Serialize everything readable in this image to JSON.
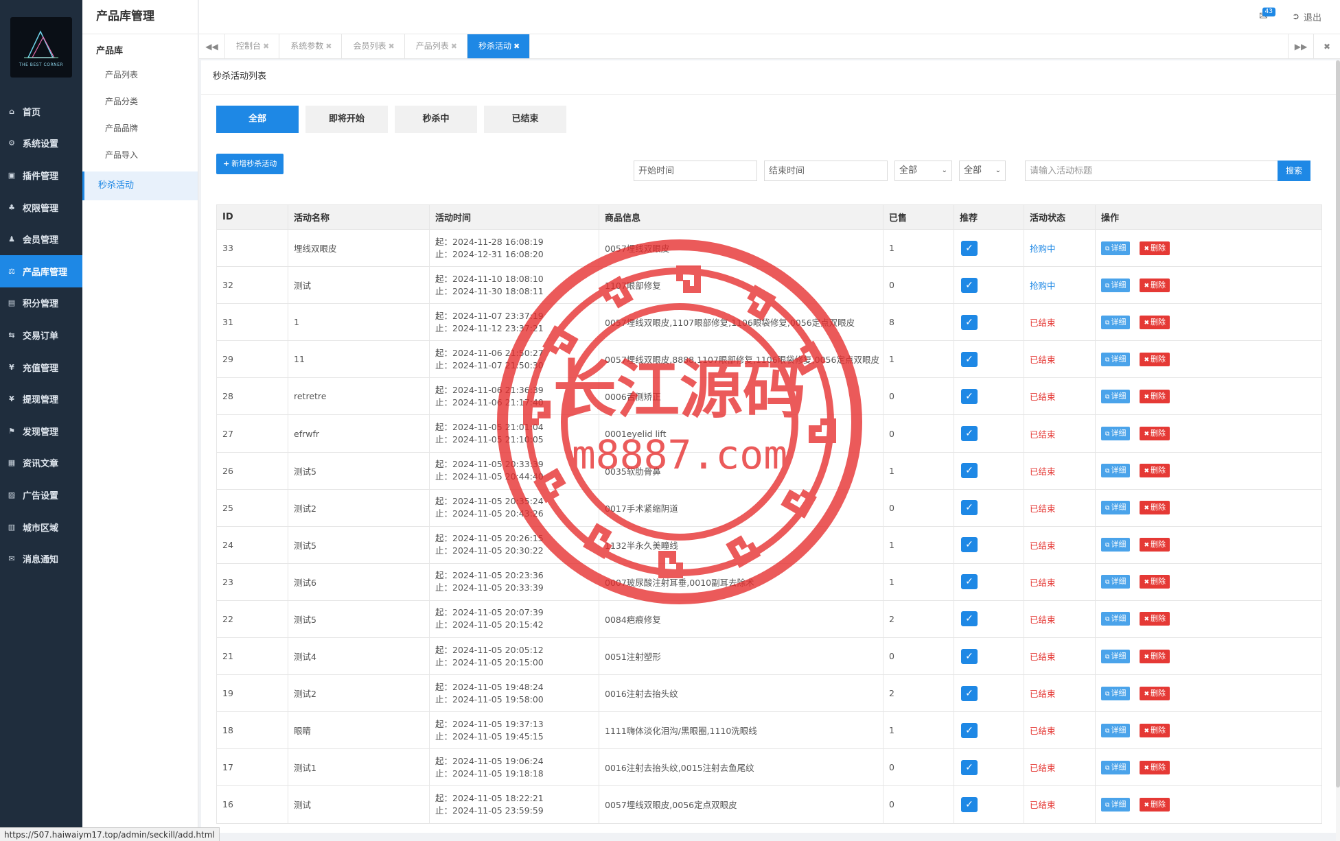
{
  "brand": {
    "logo_text": "THE BEST CORNER"
  },
  "sidebar": {
    "items": [
      {
        "label": "首页",
        "icon": "home-icon",
        "glyph": "⌂"
      },
      {
        "label": "系统设置",
        "icon": "gear-icon",
        "glyph": "⚙"
      },
      {
        "label": "插件管理",
        "icon": "plugin-icon",
        "glyph": "▣"
      },
      {
        "label": "权限管理",
        "icon": "sitemap-icon",
        "glyph": "♣"
      },
      {
        "label": "会员管理",
        "icon": "users-icon",
        "glyph": "♟"
      },
      {
        "label": "产品库管理",
        "icon": "balance-icon",
        "glyph": "⚖",
        "active": true
      },
      {
        "label": "积分管理",
        "icon": "document-icon",
        "glyph": "▤"
      },
      {
        "label": "交易订单",
        "icon": "transfer-icon",
        "glyph": "⇆"
      },
      {
        "label": "充值管理",
        "icon": "yen-icon",
        "glyph": "¥"
      },
      {
        "label": "提现管理",
        "icon": "yen-icon",
        "glyph": "¥"
      },
      {
        "label": "发现管理",
        "icon": "flag-icon",
        "glyph": "⚑"
      },
      {
        "label": "资讯文章",
        "icon": "newspaper-icon",
        "glyph": "▦"
      },
      {
        "label": "广告设置",
        "icon": "image-icon",
        "glyph": "▨"
      },
      {
        "label": "城市区域",
        "icon": "map-icon",
        "glyph": "▥"
      },
      {
        "label": "消息通知",
        "icon": "comment-icon",
        "glyph": "✉"
      }
    ]
  },
  "subsidebar": {
    "title": "产品库管理",
    "group": "产品库",
    "items": [
      "产品列表",
      "产品分类",
      "产品品牌",
      "产品导入"
    ],
    "active_item": "秒杀活动"
  },
  "header": {
    "badge": "43",
    "logout": "退出"
  },
  "tabs": [
    {
      "label": "控制台"
    },
    {
      "label": "系统参数"
    },
    {
      "label": "会员列表"
    },
    {
      "label": "产品列表"
    },
    {
      "label": "秒杀活动",
      "active": true
    }
  ],
  "panel": {
    "title": "秒杀活动列表"
  },
  "filters": {
    "tabs": [
      "全部",
      "即将开始",
      "秒杀中",
      "已结束"
    ],
    "add_button": "新增秒杀活动",
    "start_placeholder": "开始时间",
    "end_placeholder": "结束时间",
    "select_1": "全部",
    "select_2": "全部",
    "search_placeholder": "请输入活动标题",
    "search_button": "搜索"
  },
  "table": {
    "columns": [
      "ID",
      "活动名称",
      "活动时间",
      "商品信息",
      "已售",
      "推荐",
      "活动状态",
      "操作"
    ],
    "start_prefix": "起：",
    "end_prefix": "止：",
    "detail_label": "详细",
    "delete_label": "删除",
    "rows": [
      {
        "id": "33",
        "name": "埋线双眼皮",
        "start": "2024-11-28 16:08:19",
        "end": "2024-12-31 16:08:20",
        "goods": "0057埋线双眼皮",
        "sold": "1",
        "recommended": true,
        "status": "抢购中",
        "status_type": "active"
      },
      {
        "id": "32",
        "name": "测试",
        "start": "2024-11-10 18:08:10",
        "end": "2024-11-30 18:08:11",
        "goods": "1107眼部修复",
        "sold": "0",
        "recommended": true,
        "status": "抢购中",
        "status_type": "active"
      },
      {
        "id": "31",
        "name": "1",
        "start": "2024-11-07 23:37:19",
        "end": "2024-11-12 23:37:21",
        "goods": "0057埋线双眼皮,1107眼部修复,1106眼袋修复,0056定点双眼皮",
        "sold": "8",
        "recommended": true,
        "status": "已结束",
        "status_type": "ended"
      },
      {
        "id": "29",
        "name": "11",
        "start": "2024-11-06 21:50:27",
        "end": "2024-11-07 21:50:30",
        "goods": "0057埋线双眼皮,8888,1107眼部修复,1106眼袋修复,0056定点双眼皮",
        "sold": "1",
        "recommended": true,
        "status": "已结束",
        "status_type": "ended"
      },
      {
        "id": "28",
        "name": "retretre",
        "start": "2024-11-06 21:36:39",
        "end": "2024-11-06 21:17:40",
        "goods": "0006舌侧矫正",
        "sold": "0",
        "recommended": true,
        "status": "已结束",
        "status_type": "ended"
      },
      {
        "id": "27",
        "name": "efrwfr",
        "start": "2024-11-05 21:01:04",
        "end": "2024-11-05 21:10:05",
        "goods": "0001eyelid lift",
        "sold": "0",
        "recommended": true,
        "status": "已结束",
        "status_type": "ended"
      },
      {
        "id": "26",
        "name": "测试5",
        "start": "2024-11-05 20:33:39",
        "end": "2024-11-05 20:44:40",
        "goods": "0035软肋骨鼻",
        "sold": "1",
        "recommended": true,
        "status": "已结束",
        "status_type": "ended"
      },
      {
        "id": "25",
        "name": "测试2",
        "start": "2024-11-05 20:35:24",
        "end": "2024-11-05 20:43:26",
        "goods": "0017手术紧缩阴道",
        "sold": "0",
        "recommended": true,
        "status": "已结束",
        "status_type": "ended"
      },
      {
        "id": "24",
        "name": "测试5",
        "start": "2024-11-05 20:26:15",
        "end": "2024-11-05 20:30:22",
        "goods": "1132半永久美瞳线",
        "sold": "1",
        "recommended": true,
        "status": "已结束",
        "status_type": "ended"
      },
      {
        "id": "23",
        "name": "测试6",
        "start": "2024-11-05 20:23:36",
        "end": "2024-11-05 20:33:39",
        "goods": "0007玻尿酸注射耳垂,0010副耳去除术",
        "sold": "1",
        "recommended": true,
        "status": "已结束",
        "status_type": "ended"
      },
      {
        "id": "22",
        "name": "测试5",
        "start": "2024-11-05 20:07:39",
        "end": "2024-11-05 20:15:42",
        "goods": "0084疤痕修复",
        "sold": "2",
        "recommended": true,
        "status": "已结束",
        "status_type": "ended"
      },
      {
        "id": "21",
        "name": "测试4",
        "start": "2024-11-05 20:05:12",
        "end": "2024-11-05 20:15:00",
        "goods": "0051注射塑形",
        "sold": "0",
        "recommended": true,
        "status": "已结束",
        "status_type": "ended"
      },
      {
        "id": "19",
        "name": "测试2",
        "start": "2024-11-05 19:48:24",
        "end": "2024-11-05 19:58:00",
        "goods": "0016注射去抬头纹",
        "sold": "2",
        "recommended": true,
        "status": "已结束",
        "status_type": "ended"
      },
      {
        "id": "18",
        "name": "眼睛",
        "start": "2024-11-05 19:37:13",
        "end": "2024-11-05 19:45:15",
        "goods": "1111嗨体淡化泪沟/黑眼圈,1110洗眼线",
        "sold": "1",
        "recommended": true,
        "status": "已结束",
        "status_type": "ended"
      },
      {
        "id": "17",
        "name": "测试1",
        "start": "2024-11-05 19:06:24",
        "end": "2024-11-05 19:18:18",
        "goods": "0016注射去抬头纹,0015注射去鱼尾纹",
        "sold": "0",
        "recommended": true,
        "status": "已结束",
        "status_type": "ended"
      },
      {
        "id": "16",
        "name": "测试",
        "start": "2024-11-05 18:22:21",
        "end": "2024-11-05 23:59:59",
        "goods": "0057埋线双眼皮,0056定点双眼皮",
        "sold": "0",
        "recommended": true,
        "status": "已结束",
        "status_type": "ended"
      }
    ]
  },
  "watermark": {
    "title": "长江源码",
    "url": "m8887.com",
    "color": "#e62c2c"
  },
  "status_url": "https://507.haiwaiym17.top/admin/seckill/add.html",
  "colors": {
    "accent": "#1e88e5",
    "sidebar_bg": "#1f2d3d",
    "danger": "#e53935"
  }
}
